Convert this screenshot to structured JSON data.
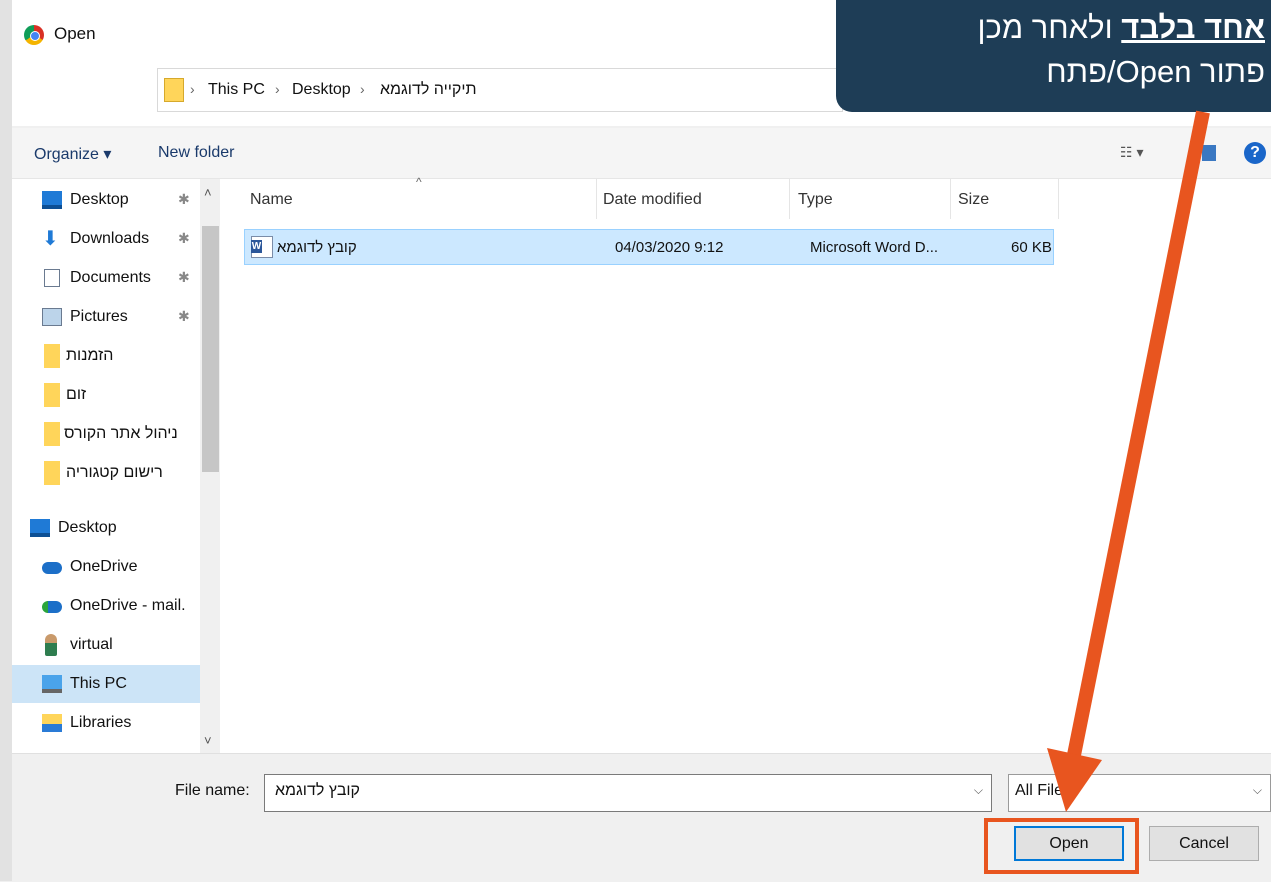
{
  "dialog": {
    "title": "Open"
  },
  "address": {
    "crumbs": [
      "This PC",
      "Desktop",
      "תיקייה לדוגמא"
    ]
  },
  "toolbar": {
    "organize_label": "Organize ▾",
    "new_folder_label": "New folder"
  },
  "nav_pane": {
    "items": [
      {
        "label": "Desktop",
        "icon": "desktop-icon",
        "pinned": true
      },
      {
        "label": "Downloads",
        "icon": "downloads-icon",
        "pinned": true
      },
      {
        "label": "Documents",
        "icon": "documents-icon",
        "pinned": true
      },
      {
        "label": "Pictures",
        "icon": "pictures-icon",
        "pinned": true
      },
      {
        "label": "הזמנות",
        "icon": "folder-icon",
        "pinned": false
      },
      {
        "label": "זום",
        "icon": "folder-icon",
        "pinned": false
      },
      {
        "label": "ניהול אתר הקורס",
        "icon": "folder-icon",
        "pinned": false
      },
      {
        "label": "רישום קטגוריה",
        "icon": "folder-icon",
        "pinned": false
      },
      {
        "label": "Desktop",
        "icon": "desktop-icon",
        "pinned": false
      },
      {
        "label": "OneDrive",
        "icon": "onedrive-icon",
        "pinned": false
      },
      {
        "label": "OneDrive - mail.",
        "icon": "onedrive-business-icon",
        "pinned": false
      },
      {
        "label": "virtual",
        "icon": "user-icon",
        "pinned": false
      },
      {
        "label": "This PC",
        "icon": "computer-icon",
        "pinned": false,
        "selected": true
      },
      {
        "label": "Libraries",
        "icon": "libraries-icon",
        "pinned": false
      }
    ]
  },
  "file_list": {
    "columns": [
      "Name",
      "Date modified",
      "Type",
      "Size"
    ],
    "rows": [
      {
        "name": "קובץ לדוגמא",
        "date": "04/03/2020 9:12",
        "type": "Microsoft Word D...",
        "size": "60 KB"
      }
    ]
  },
  "bottom": {
    "file_name_label": "File name:",
    "file_name_value": "קובץ לדוגמא",
    "filter_value": "All Files",
    "open_label": "Open",
    "cancel_label": "Cancel"
  },
  "callout": {
    "underlined": "אחד בלבד",
    "line1_rest": " ולאחר מכן",
    "line2": "פתור Open/פתח"
  },
  "colors": {
    "callout_bg": "#1e3d56",
    "arrow": "#e8551f",
    "selection": "#cce8ff"
  }
}
